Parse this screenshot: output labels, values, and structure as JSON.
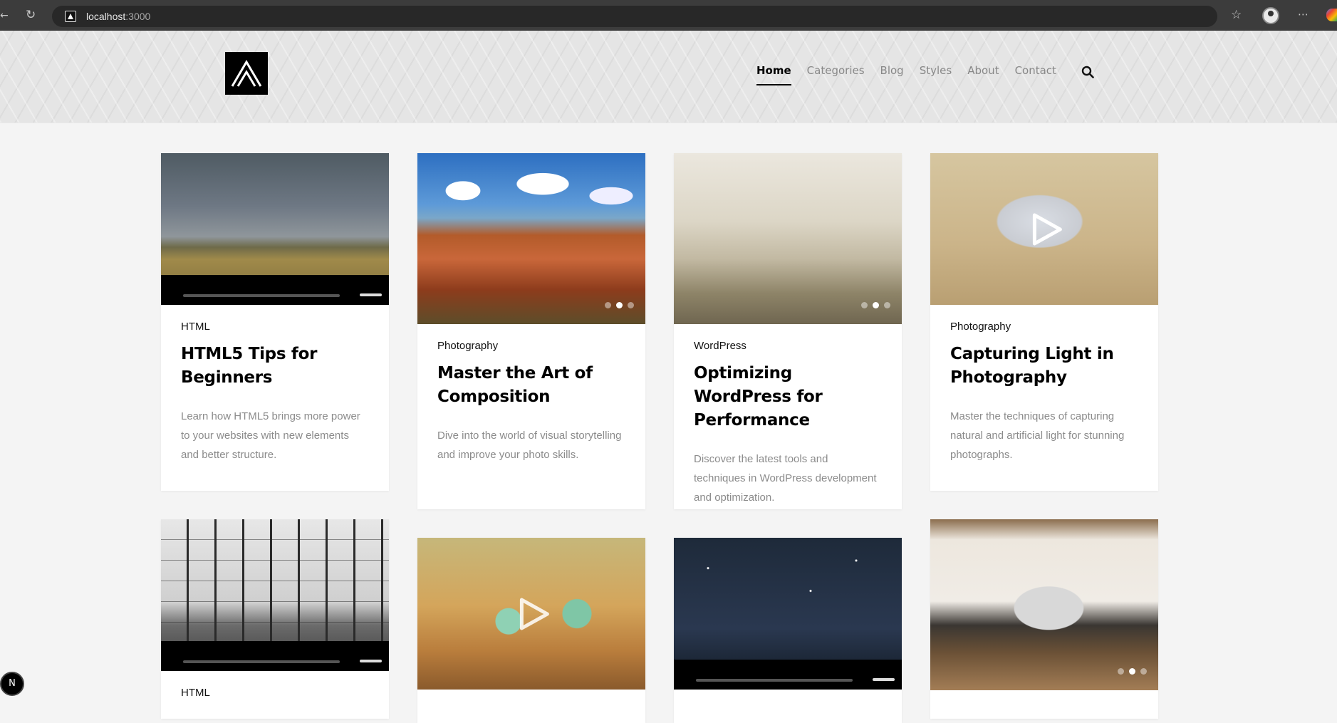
{
  "browser": {
    "url_host": "localhost",
    "url_port": ":3000"
  },
  "site": {
    "logo_alt": "logo",
    "nav": [
      {
        "label": "Home",
        "active": true
      },
      {
        "label": "Categories",
        "active": false
      },
      {
        "label": "Blog",
        "active": false
      },
      {
        "label": "Styles",
        "active": false
      },
      {
        "label": "About",
        "active": false
      },
      {
        "label": "Contact",
        "active": false
      }
    ]
  },
  "posts": [
    {
      "category": "HTML",
      "title": "HTML5 Tips for Beginners",
      "excerpt": "Learn how HTML5 brings more power to your websites with new elements and better structure.",
      "media": "video"
    },
    {
      "category": "Photography",
      "title": "Master the Art of Composition",
      "excerpt": "Dive into the world of visual storytelling and improve your photo skills.",
      "media": "gallery"
    },
    {
      "category": "WordPress",
      "title": "Optimizing WordPress for Performance",
      "excerpt": "Discover the latest tools and techniques in WordPress development and optimization.",
      "media": "gallery"
    },
    {
      "category": "Photography",
      "title": "Capturing Light in Photography",
      "excerpt": "Master the techniques of capturing natural and artificial light for stunning photographs.",
      "media": "video-play"
    },
    {
      "category": "HTML",
      "title": "",
      "excerpt": "",
      "media": "video"
    },
    {
      "category": "",
      "title": "",
      "excerpt": "",
      "media": "video-play"
    },
    {
      "category": "",
      "title": "",
      "excerpt": "",
      "media": "video"
    },
    {
      "category": "",
      "title": "",
      "excerpt": "",
      "media": "gallery"
    }
  ],
  "dev_badge": "N"
}
